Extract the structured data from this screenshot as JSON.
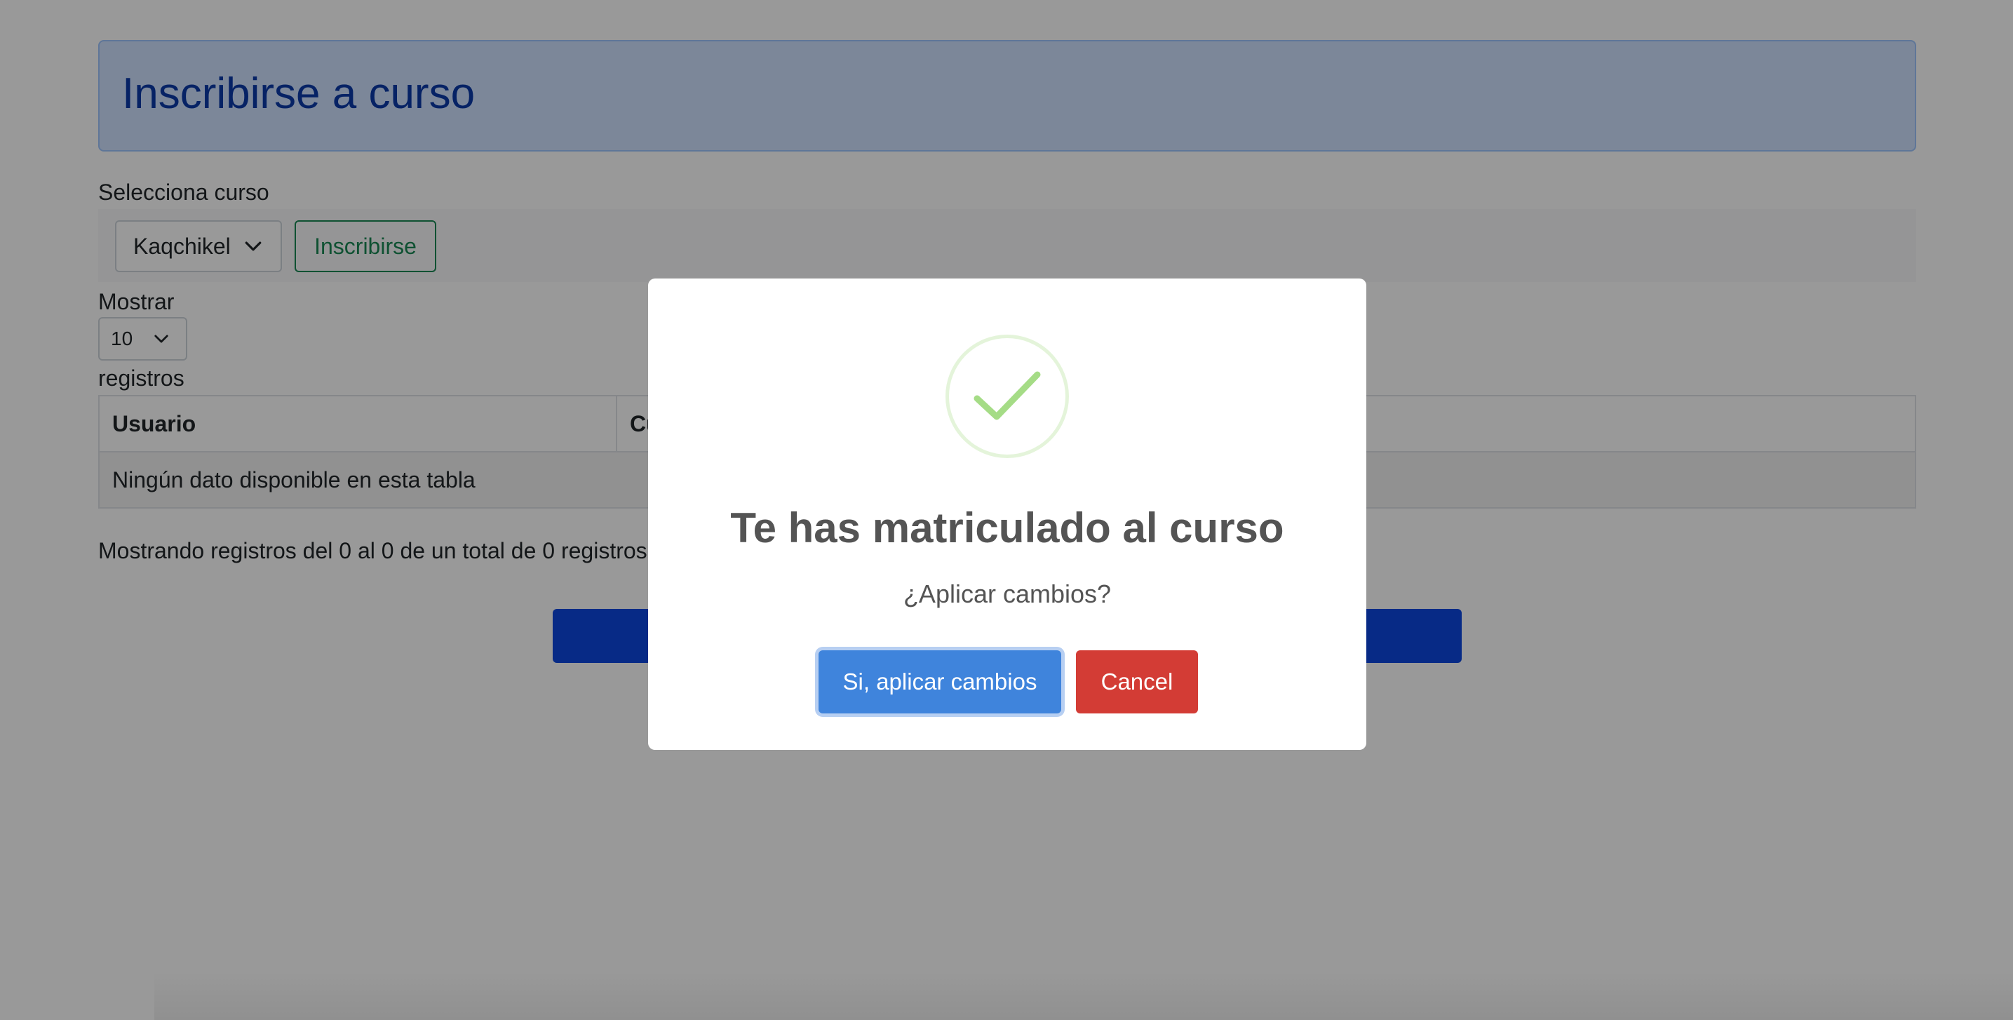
{
  "header": {
    "title": "Inscribirse a curso"
  },
  "course_form": {
    "label": "Selecciona curso",
    "selected_course": "Kaqchikel",
    "enroll_label": "Inscribirse"
  },
  "table_length": {
    "prefix": "Mostrar",
    "value": "10",
    "suffix": "registros"
  },
  "table": {
    "columns": [
      "Usuario",
      "Curso"
    ],
    "empty_message": "Ningún dato disponible en esta tabla"
  },
  "table_info": "Mostrando registros del 0 al 0 de un total de 0 registros",
  "modal": {
    "title": "Te has matriculado al curso",
    "text": "¿Aplicar cambios?",
    "confirm_label": "Si, aplicar cambios",
    "cancel_label": "Cancel",
    "icon": "success-check-icon"
  },
  "colors": {
    "banner_bg": "#cfe2ff",
    "banner_text": "#0a3aa8",
    "success_outline": "#198754",
    "primary_bar": "#0d47e0",
    "confirm": "#3f84dc",
    "cancel": "#d33c35",
    "check": "#a5dc86"
  }
}
